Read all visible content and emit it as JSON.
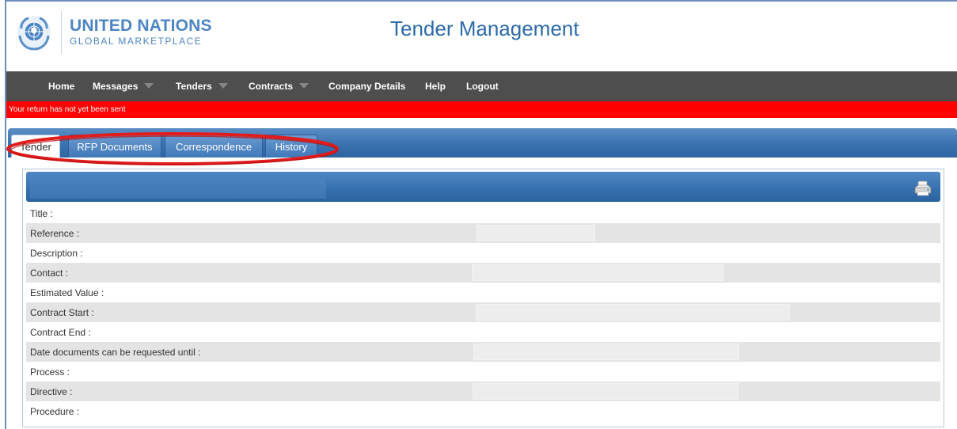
{
  "branding": {
    "org_line1": "UNITED NATIONS",
    "org_line2": "GLOBAL MARKETPLACE",
    "logo_icon": "un-emblem-icon"
  },
  "page_title": "Tender Management",
  "nav": {
    "items": [
      {
        "label": "Home",
        "has_dropdown": false
      },
      {
        "label": "Messages",
        "has_dropdown": true
      },
      {
        "label": "Tenders",
        "has_dropdown": true
      },
      {
        "label": "Contracts",
        "has_dropdown": true
      },
      {
        "label": "Company Details",
        "has_dropdown": false
      },
      {
        "label": "Help",
        "has_dropdown": false
      },
      {
        "label": "Logout",
        "has_dropdown": false
      }
    ]
  },
  "alert": {
    "text": "Your return has not yet been sent",
    "color": "#ff0000"
  },
  "tabs": [
    {
      "label": "Tender",
      "active": true
    },
    {
      "label": "RFP Documents",
      "active": false
    },
    {
      "label": "Correspondence",
      "active": false
    },
    {
      "label": "History",
      "active": false
    }
  ],
  "annotation": {
    "type": "ellipse-highlight",
    "color": "#e21b1b",
    "target": "tabs"
  },
  "details": {
    "print_icon": "printer-icon",
    "fields": [
      {
        "label": "Title :",
        "value": ""
      },
      {
        "label": "Reference :",
        "value": ""
      },
      {
        "label": "Description :",
        "value": ""
      },
      {
        "label": "Contact :",
        "value": ""
      },
      {
        "label": "Estimated Value :",
        "value": ""
      },
      {
        "label": "Contract Start :",
        "value": ""
      },
      {
        "label": "Contract End :",
        "value": ""
      },
      {
        "label": "Date documents can be requested until :",
        "value": ""
      },
      {
        "label": "Process :",
        "value": ""
      },
      {
        "label": "Directive :",
        "value": ""
      },
      {
        "label": "Procedure :",
        "value": ""
      }
    ]
  },
  "colors": {
    "brand_blue": "#4d85c4",
    "nav_bg": "#4e4e4e",
    "tab_bar_blue": "#3a72b0",
    "row_shade": "#e4e4e4"
  }
}
